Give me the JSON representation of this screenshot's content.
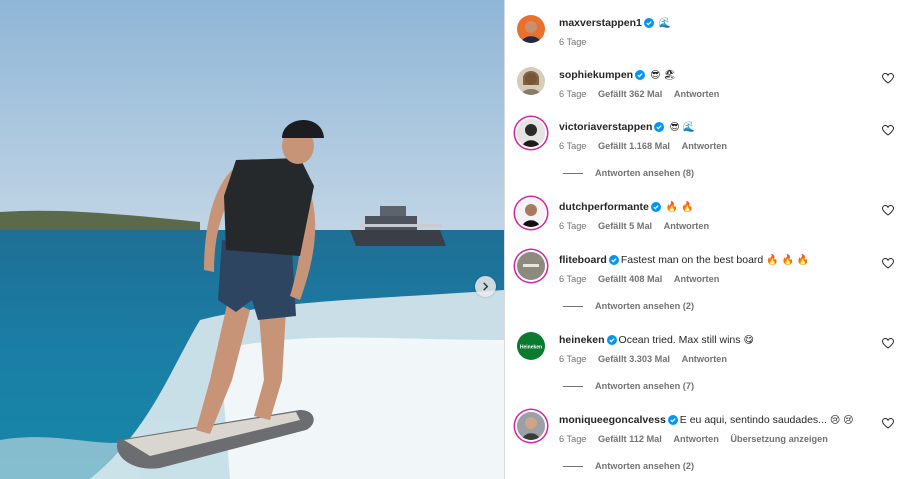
{
  "post": {
    "author": "maxverstappen1",
    "caption_emoji": "🌊",
    "time": "6 Tage"
  },
  "comments": [
    {
      "user": "sophiekumpen",
      "text": "",
      "emoji": "😎 🏖",
      "time": "6 Tage",
      "likes": "Gefällt 362 Mal",
      "reply": "Antworten"
    },
    {
      "user": "victoriaverstappen",
      "text": "",
      "emoji": "😎 🌊",
      "time": "6 Tage",
      "likes": "Gefällt 1.168 Mal",
      "reply": "Antworten",
      "view_replies": "Antworten ansehen (8)"
    },
    {
      "user": "dutchperformante",
      "text": "",
      "emoji": "🔥 🔥",
      "time": "6 Tage",
      "likes": "Gefällt 5 Mal",
      "reply": "Antworten"
    },
    {
      "user": "fliteboard",
      "text": "Fastest man on the best board",
      "emoji": "🔥 🔥 🔥",
      "time": "6 Tage",
      "likes": "Gefällt 408 Mal",
      "reply": "Antworten",
      "view_replies": "Antworten ansehen (2)"
    },
    {
      "user": "heineken",
      "text": "Ocean tried. Max still wins",
      "emoji": "😋",
      "time": "6 Tage",
      "likes": "Gefällt 3.303 Mal",
      "reply": "Antworten",
      "view_replies": "Antworten ansehen (7)"
    },
    {
      "user": "moniqueegoncalvess",
      "text": "E eu aqui, sentindo saudades...",
      "emoji": "😢 😢",
      "time": "6 Tage",
      "likes": "Gefällt 112 Mal",
      "reply": "Antworten",
      "translate": "Übersetzung anzeigen",
      "view_replies": "Antworten ansehen (2)"
    }
  ],
  "avatars": {
    "heineken_label": "Heineken"
  },
  "colors": {
    "verified": "#0095f6",
    "meta": "#737373",
    "ring": "#d6249f"
  }
}
